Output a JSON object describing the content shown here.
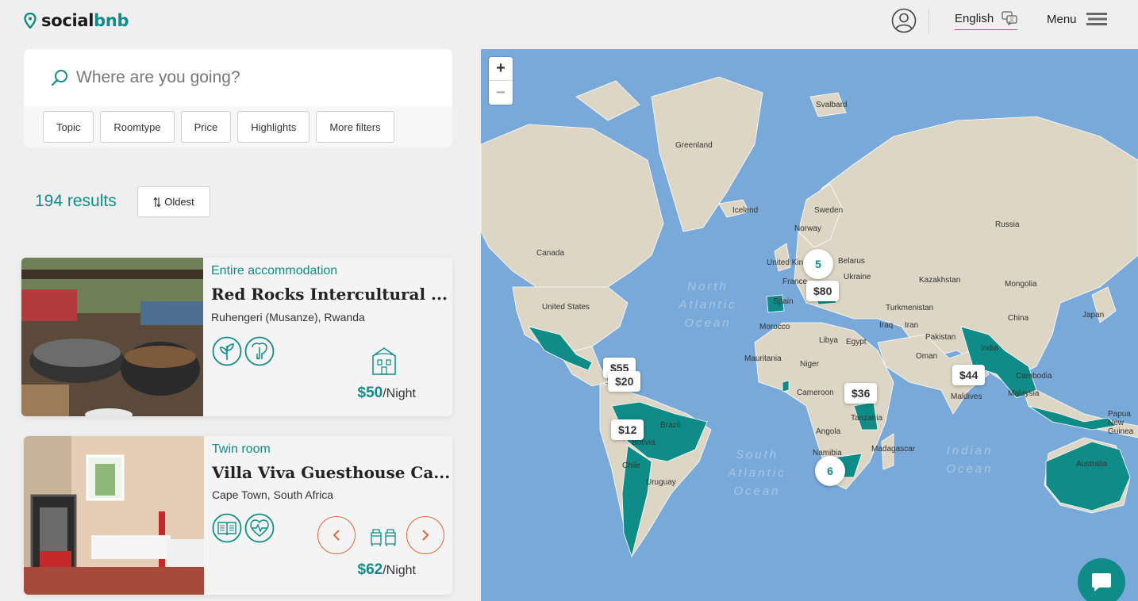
{
  "header": {
    "logo_part1": "social",
    "logo_part2": "bnb",
    "language_label": "English",
    "menu_label": "Menu"
  },
  "search": {
    "placeholder": "Where are you going?",
    "filters": [
      "Topic",
      "Roomtype",
      "Price",
      "Highlights",
      "More filters"
    ]
  },
  "results": {
    "count_label": "194 results",
    "sort_label": "Oldest"
  },
  "listings": [
    {
      "type": "Entire accommodation",
      "title": "Red Rocks Intercultural ...",
      "location": "Ruhengeri (Musanze), Rwanda",
      "price": "$50",
      "per": "/Night",
      "amenities": [
        "plant-icon",
        "elephant-icon"
      ],
      "room_icon": "house-icon"
    },
    {
      "type": "Twin room",
      "title": "Villa Viva Guesthouse Ca...",
      "location": "Cape Town, South Africa",
      "price": "$62",
      "per": "/Night",
      "amenities": [
        "book-icon",
        "heartbeat-icon"
      ],
      "room_icon": "beds-icon"
    }
  ],
  "map": {
    "zoom_in": "+",
    "zoom_out": "−",
    "countries": [
      "Greenland",
      "Svalbard",
      "Iceland",
      "Sweden",
      "Norway",
      "Russia",
      "Canada",
      "United Kingdom",
      "Belarus",
      "Ukraine",
      "France",
      "Kazakhstan",
      "Mongolia",
      "United States",
      "Spain",
      "Turkmenistan",
      "China",
      "Morocco",
      "Iraq",
      "Iran",
      "Japan",
      "Libya",
      "Egypt",
      "Pakistan",
      "Mauritania",
      "Niger",
      "Oman",
      "India",
      "Cameroon",
      "Maldives",
      "Malaysia",
      "Cambodia",
      "Brazil",
      "Tanzania",
      "Papua New Guinea",
      "Angola",
      "Bolivia",
      "Madagascar",
      "Namibia",
      "Chile",
      "Uruguay",
      "Australia"
    ],
    "oceans": [
      "North Atlantic Ocean",
      "South Atlantic Ocean",
      "Indian Ocean"
    ],
    "price_pins": [
      "$80",
      "$55",
      "$20",
      "$12",
      "$36",
      "$44"
    ],
    "clusters": [
      "5",
      "6"
    ]
  },
  "colors": {
    "accent": "#0f8c88",
    "arrow": "#e2643a",
    "ocean": "#78a9d8",
    "land": "#ddd6c5"
  }
}
